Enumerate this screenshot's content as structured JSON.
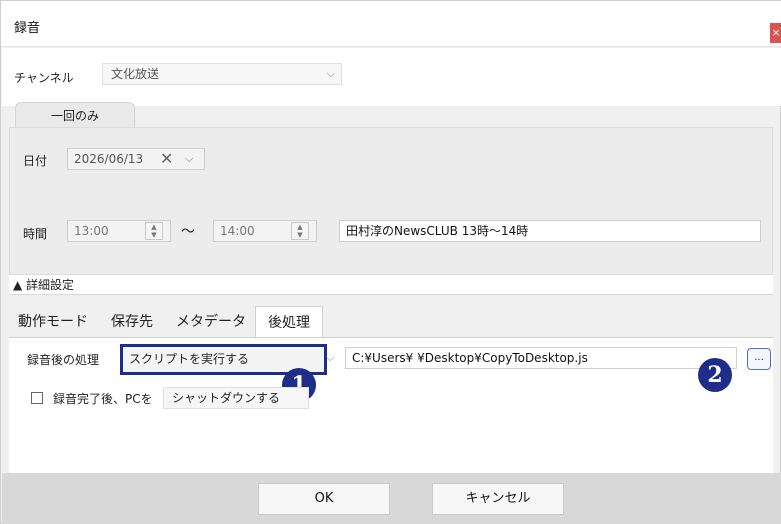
{
  "window": {
    "title": "録音",
    "close_label": "×"
  },
  "channel": {
    "label": "チャンネル",
    "value": "文化放送"
  },
  "mode_tab": {
    "label": "一回のみ"
  },
  "date": {
    "label": "日付",
    "value": "2026/06/13",
    "clear": "✕",
    "dropdown": "⌵"
  },
  "time": {
    "label": "時間",
    "start": "13:00",
    "separator": "〜",
    "end": "14:00",
    "program_title": "田村淳のNewsCLUB 13時〜14時"
  },
  "details": {
    "toggle_label": "▲ 詳細設定"
  },
  "tabs": [
    {
      "label": "動作モード"
    },
    {
      "label": "保存先"
    },
    {
      "label": "メタデータ"
    },
    {
      "label": "後処理"
    }
  ],
  "postprocess": {
    "label": "録音後の処理",
    "action_value": "スクリプトを実行する",
    "script_path": "C:¥Users¥        ¥Desktop¥CopyToDesktop.js",
    "browse_label": "...",
    "after_label": "録音完了後、PCを",
    "after_value": "シャットダウンする"
  },
  "badges": {
    "one": "1",
    "two": "2"
  },
  "footer": {
    "ok_label": "OK",
    "cancel_label": "キャンセル"
  },
  "colors": {
    "badge": "#1f2d8a",
    "highlight_border": "#1f2d8a",
    "close_button": "#d9534f"
  }
}
